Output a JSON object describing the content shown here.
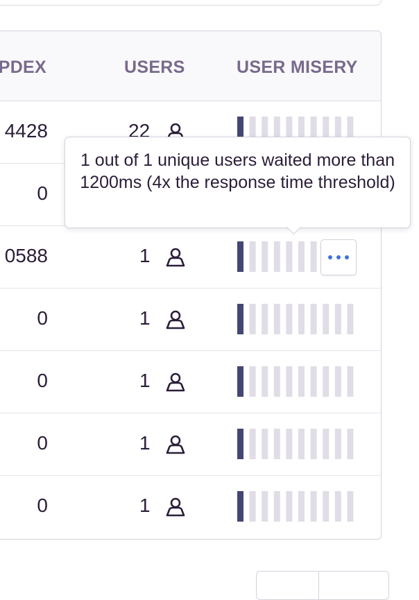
{
  "table": {
    "headers": {
      "apdex": "PDEX",
      "users": "USERS",
      "user_misery": "USER MISERY"
    },
    "rows": [
      {
        "apdex": "4428",
        "users": "22",
        "misery_filled": 1,
        "misery_total": 10
      },
      {
        "apdex": "0",
        "users": "",
        "misery_filled": 0,
        "misery_total": 10
      },
      {
        "apdex": "0588",
        "users": "1",
        "misery_filled": 1,
        "misery_total": 10
      },
      {
        "apdex": "0",
        "users": "1",
        "misery_filled": 1,
        "misery_total": 10
      },
      {
        "apdex": "0",
        "users": "1",
        "misery_filled": 1,
        "misery_total": 10
      },
      {
        "apdex": "0",
        "users": "1",
        "misery_filled": 1,
        "misery_total": 10
      },
      {
        "apdex": "0",
        "users": "1",
        "misery_filled": 1,
        "misery_total": 10
      }
    ]
  },
  "tooltip": {
    "text": "1 out of 1 unique users waited more than 1200ms (4x the response time threshold)"
  },
  "icons": {
    "user": "user-icon",
    "more": "ellipsis-icon"
  },
  "colors": {
    "misery_filled": "#444674",
    "misery_empty": "#e0dde6",
    "more_dots": "#3d74db",
    "header_text": "#786a8c"
  }
}
